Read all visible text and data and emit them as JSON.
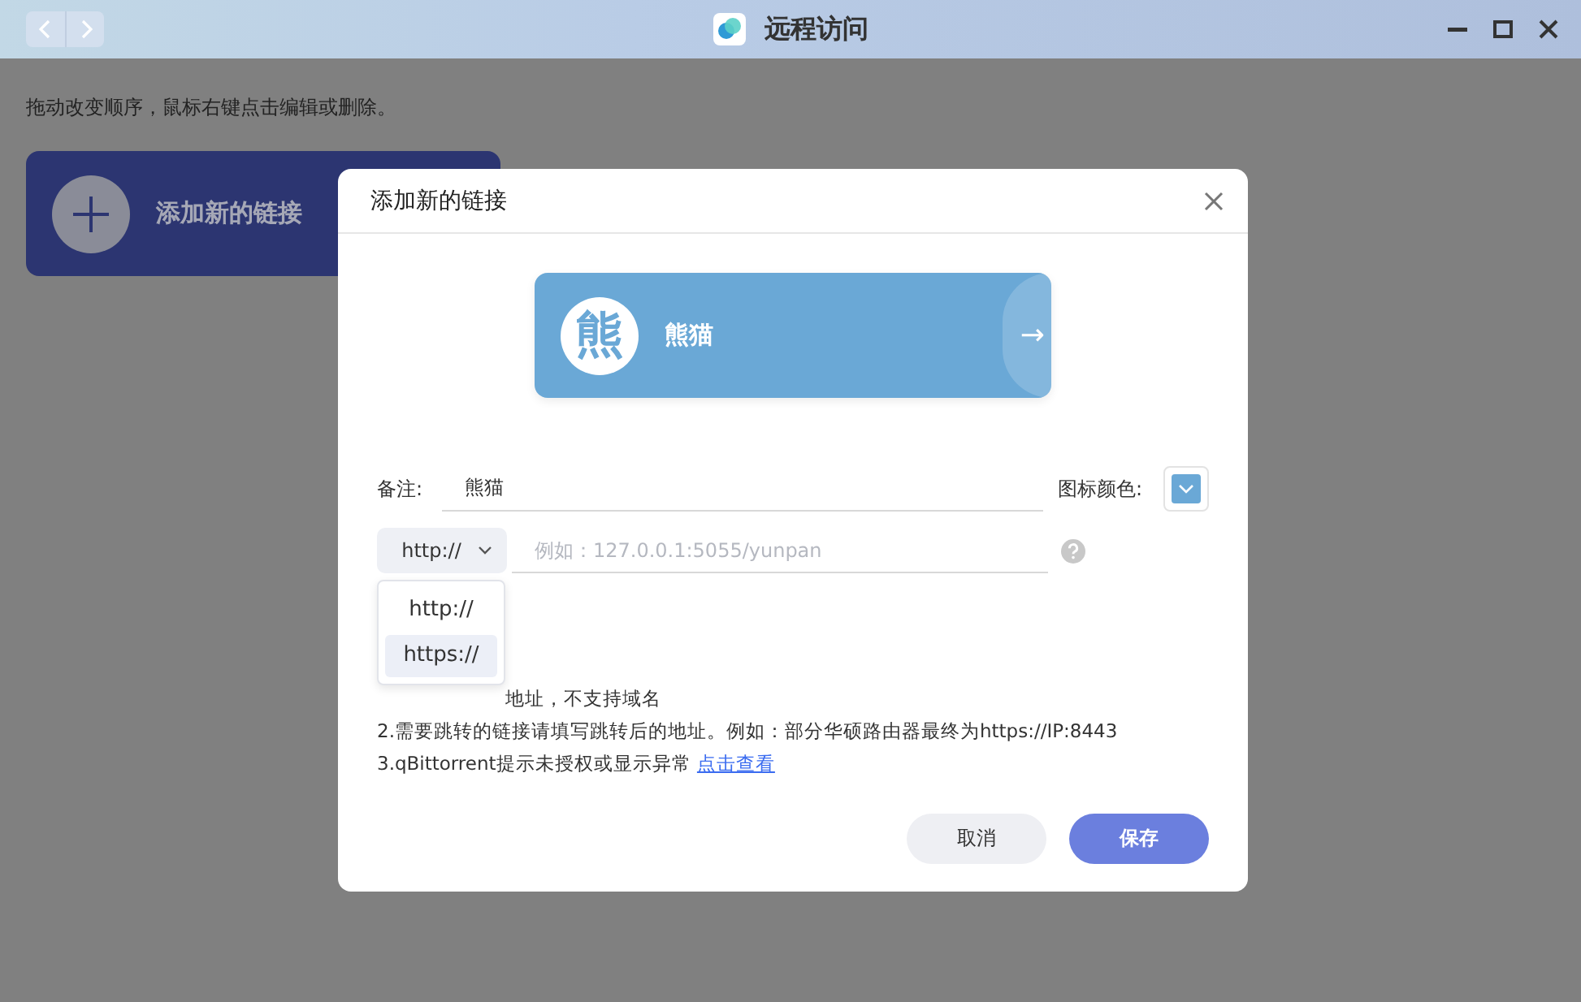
{
  "window": {
    "title": "远程访问"
  },
  "hint": "拖动改变顺序，鼠标右键点击编辑或删除。",
  "add_card": {
    "label": "添加新的链接"
  },
  "dialog": {
    "title": "添加新的链接",
    "preview": {
      "icon_char": "熊",
      "name": "熊猫",
      "arrow": "→",
      "color": "#6aa8d6"
    },
    "note": {
      "label": "备注:",
      "value": "熊猫"
    },
    "icon_color": {
      "label": "图标颜色:",
      "color": "#6aa8d6"
    },
    "protocol": {
      "value": "http://",
      "expanded": true,
      "options": [
        {
          "label": "http://",
          "highlighted": false
        },
        {
          "label": "https://",
          "highlighted": true
        }
      ]
    },
    "address": {
      "placeholder": "例如：127.0.0.1:5055/yunpan"
    },
    "notes": [
      {
        "text": "地址，不支持域名"
      },
      {
        "text": "2.需要跳转的链接请填写跳转后的地址。例如：部分华硕路由器最终为https://IP:8443"
      },
      {
        "text": "3.qBittorrent提示未授权或显示异常",
        "link": "点击查看"
      }
    ],
    "buttons": [
      {
        "label": "取消",
        "kind": "secondary"
      },
      {
        "label": "保存",
        "kind": "primary"
      }
    ]
  }
}
